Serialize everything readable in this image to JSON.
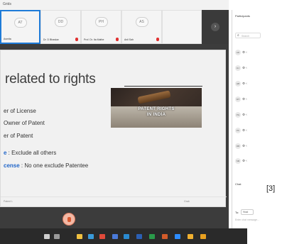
{
  "top_bar": {
    "label": "Grids"
  },
  "thumbnails": [
    {
      "initials": "AT",
      "name": "Asmita",
      "active": true
    },
    {
      "initials": "DD",
      "name": "Dr. D Bhaskar",
      "active": false
    },
    {
      "initials": "PH",
      "name": "Prof. Dr. Ita Mathe",
      "active": false
    },
    {
      "initials": "AS",
      "name": "Anil Sah",
      "active": false
    }
  ],
  "strip_next_icon": "chevron-right-icon",
  "slide": {
    "title": "related to rights",
    "bullets": [
      {
        "prefix": "",
        "text": "er of License"
      },
      {
        "prefix": "",
        "text": "Owner of Patent"
      },
      {
        "prefix": "",
        "text": "er of Patent"
      },
      {
        "prefix": "e",
        "text": " : Exclude all others"
      },
      {
        "prefix": "cense",
        "text": " : No one exclude Patentee"
      }
    ],
    "image_caption_line1": "PATENT RIGHTS",
    "image_caption_line2": "IN INDIA",
    "footer_left": "Patent L",
    "footer_right": "Grab"
  },
  "panel": {
    "participants_title": "Participants",
    "search_placeholder": "Search",
    "participant_rows": [
      "AD",
      "DJ",
      "HB",
      "MT",
      "PG",
      "PK",
      "RB",
      "SM"
    ],
    "chat_title": "Chat",
    "chat_to_label": "To:",
    "chat_to_value": "Host",
    "chat_input_placeholder": "Enter chat message..."
  },
  "ref_label": "[3]",
  "colors": {
    "accent": "#1e7bd8",
    "highlight_text": "#2166c9",
    "mic_muted": "#e03030"
  },
  "taskbar_icons": [
    "start-icon",
    "search-icon",
    "explorer-icon",
    "edge-icon",
    "chrome-icon",
    "store-icon",
    "mail-icon",
    "word-icon",
    "excel-icon",
    "powerpoint-icon",
    "zoom-icon",
    "folder-icon"
  ]
}
